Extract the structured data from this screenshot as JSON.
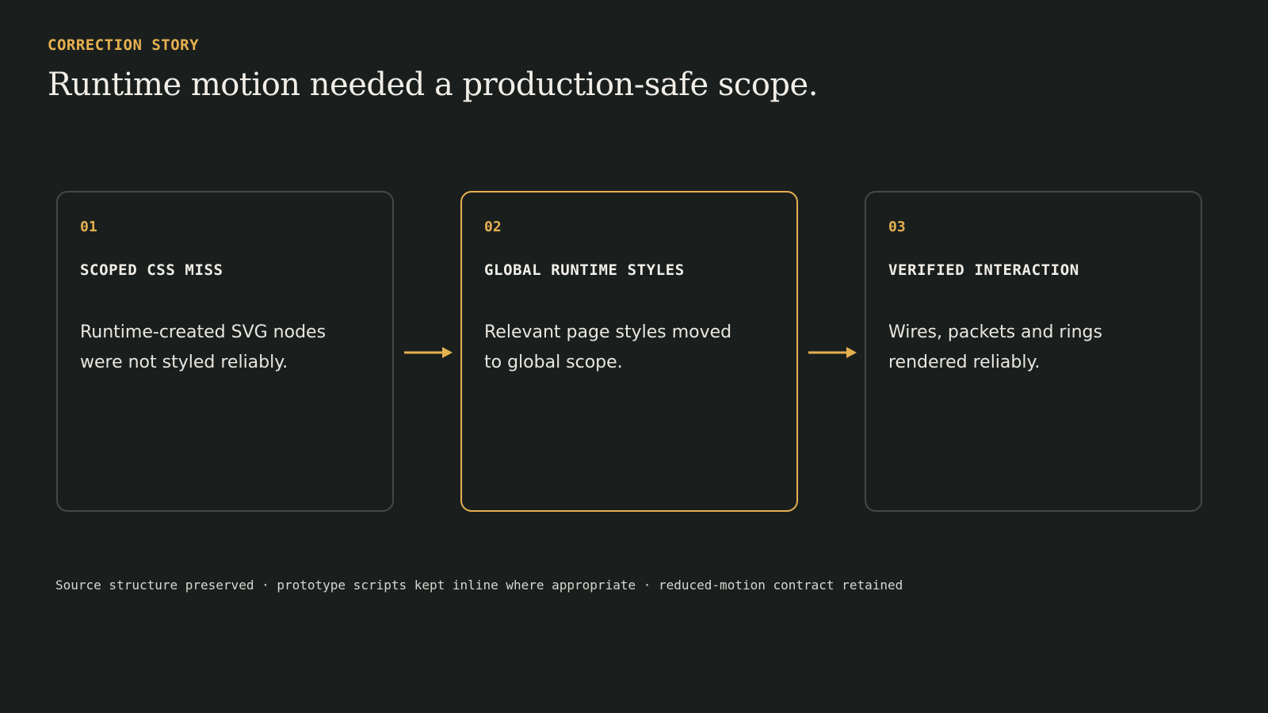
{
  "header": {
    "eyebrow": "CORRECTION STORY",
    "title": "Runtime motion needed a production-safe scope."
  },
  "cards": [
    {
      "number": "01",
      "heading": "SCOPED CSS MISS",
      "body": "Runtime-created SVG nodes were not styled reliably."
    },
    {
      "number": "02",
      "heading": "GLOBAL RUNTIME STYLES",
      "body": "Relevant page styles moved to global scope.",
      "highlighted": true
    },
    {
      "number": "03",
      "heading": "VERIFIED INTERACTION",
      "body": "Wires, packets and rings rendered reliably."
    }
  ],
  "footer": {
    "text": "Source structure preserved · prototype scripts kept inline where appropriate · reduced-motion contract retained"
  },
  "colors": {
    "background": "#1a1f1e",
    "accent": "#e6b04f",
    "card_border": "#414a47",
    "text": "#e9e6df"
  },
  "icons": {
    "connector": "arrow-right-icon"
  }
}
